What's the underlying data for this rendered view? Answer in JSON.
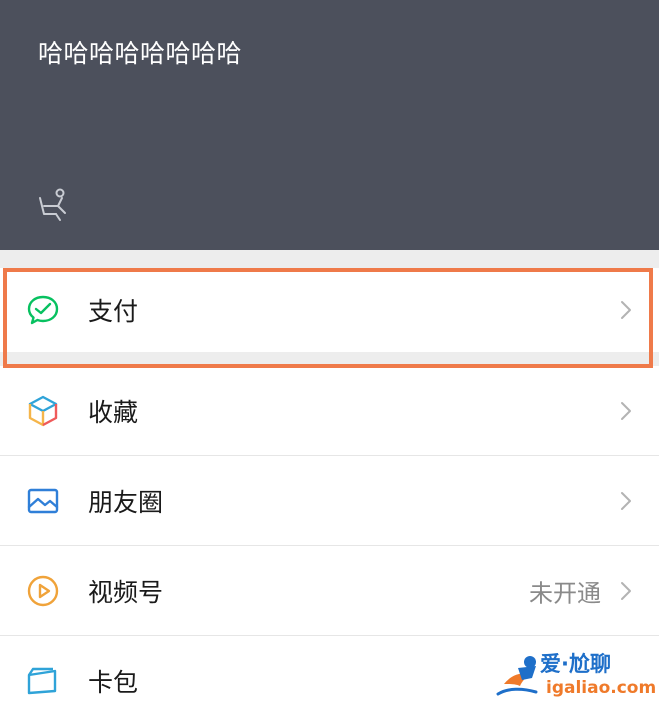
{
  "header": {
    "user_name": "哈哈哈哈哈哈哈哈",
    "status_icon": "status-icon",
    "background": "#4c505c"
  },
  "menu": {
    "items": [
      {
        "label": "支付",
        "icon": "pay-icon",
        "accent": "#07c160"
      },
      {
        "label": "收藏",
        "icon": "favorites-cube-icon",
        "accent": "#f5b54a"
      },
      {
        "label": "朋友圈",
        "icon": "moments-picture-icon",
        "accent": "#2f7fd8"
      },
      {
        "label": "视频号",
        "icon": "channels-play-icon",
        "accent": "#f0a33a",
        "status": "未开通"
      },
      {
        "label": "卡包",
        "icon": "card-wallet-icon",
        "accent": "#2fa3d8"
      }
    ]
  },
  "highlight": {
    "color": "#ef7a4a"
  },
  "watermark": {
    "title": "爱·尬聊",
    "site": "igaliao.com"
  }
}
